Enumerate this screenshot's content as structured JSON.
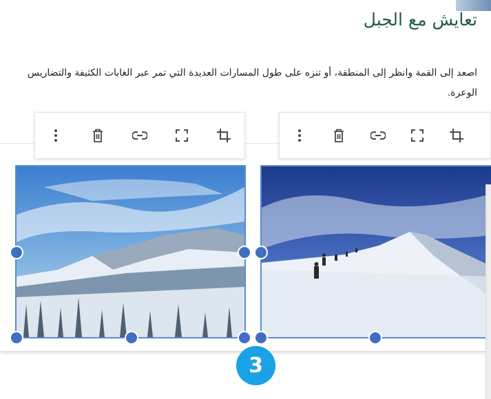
{
  "document": {
    "title": "تعايش مع الجبل",
    "body": "اصعد إلى القمة وانظر إلى المنطقة، أو تنزه على طول المسارات العديدة التي تمر عبر الغابات الكثيفة والتضاريس الوعرة."
  },
  "toolbar": {
    "icons": [
      "more-vertical-icon",
      "delete-icon",
      "link-icon",
      "fullscreen-icon",
      "crop-icon"
    ]
  },
  "images": [
    {
      "name": "snowy-forest-mountain-image"
    },
    {
      "name": "hikers-snow-ridge-image"
    }
  ],
  "step_badge": "3",
  "colors": {
    "title": "#1f5a4c",
    "selection": "#5a8bd0",
    "handle": "#3f6fc1",
    "badge": "#1ba1e6",
    "icon": "#4a4a4a"
  }
}
